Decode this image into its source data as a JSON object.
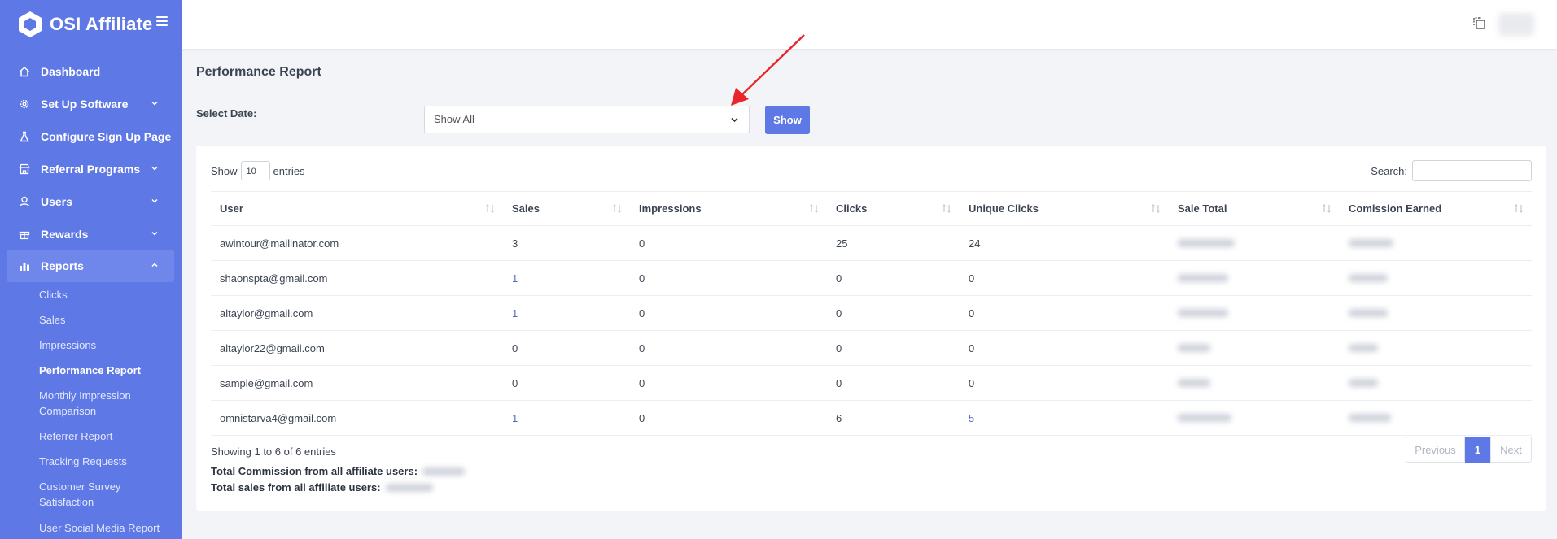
{
  "brand": {
    "name": "OSI Affiliate"
  },
  "sidebar": {
    "items": [
      {
        "label": "Dashboard",
        "icon": "home-icon"
      },
      {
        "label": "Set Up Software",
        "icon": "gear-icon",
        "has_chevron": true
      },
      {
        "label": "Configure Sign Up Page",
        "icon": "flask-icon"
      },
      {
        "label": "Referral Programs",
        "icon": "store-icon",
        "has_chevron": true
      },
      {
        "label": "Users",
        "icon": "user-icon",
        "has_chevron": true
      },
      {
        "label": "Rewards",
        "icon": "gift-icon",
        "has_chevron": true
      },
      {
        "label": "Reports",
        "icon": "chart-icon",
        "has_chevron": true,
        "expanded": true
      }
    ],
    "report_subitems": [
      "Clicks",
      "Sales",
      "Impressions",
      "Performance Report",
      "Monthly Impression Comparison",
      "Referrer Report",
      "Tracking Requests",
      "Customer Survey Satisfaction",
      "User Social Media Report"
    ],
    "current_subitem": "Performance Report"
  },
  "page": {
    "title": "Performance Report",
    "date_label": "Select Date:",
    "date_value": "Show All",
    "show_button": "Show"
  },
  "table_controls": {
    "show_label": "Show",
    "entries_value": "10",
    "entries_label": "entries",
    "search_label": "Search:"
  },
  "table": {
    "columns": [
      "User",
      "Sales",
      "Impressions",
      "Clicks",
      "Unique Clicks",
      "Sale Total",
      "Comission Earned"
    ],
    "rows": [
      {
        "user": "awintour@mailinator.com",
        "sales": "3",
        "impressions": "0",
        "clicks": "25",
        "unique_clicks": "24"
      },
      {
        "user": "shaonspta@gmail.com",
        "sales": "1",
        "impressions": "0",
        "clicks": "0",
        "unique_clicks": "0"
      },
      {
        "user": "altaylor@gmail.com",
        "sales": "1",
        "impressions": "0",
        "clicks": "0",
        "unique_clicks": "0"
      },
      {
        "user": "altaylor22@gmail.com",
        "sales": "0",
        "impressions": "0",
        "clicks": "0",
        "unique_clicks": "0"
      },
      {
        "user": "sample@gmail.com",
        "sales": "0",
        "impressions": "0",
        "clicks": "0",
        "unique_clicks": "0"
      },
      {
        "user": "omnistarva4@gmail.com",
        "sales": "1",
        "impressions": "0",
        "clicks": "6",
        "unique_clicks": "5"
      }
    ]
  },
  "footer": {
    "info": "Showing 1 to 6 of 6 entries",
    "total_commission_label": "Total Commission from all affiliate users:",
    "total_sales_label": "Total sales from all affiliate users:"
  },
  "pagination": {
    "prev": "Previous",
    "page": "1",
    "next": "Next"
  },
  "colors": {
    "accent": "#5e78e6",
    "annotation_arrow": "#e8262b"
  }
}
